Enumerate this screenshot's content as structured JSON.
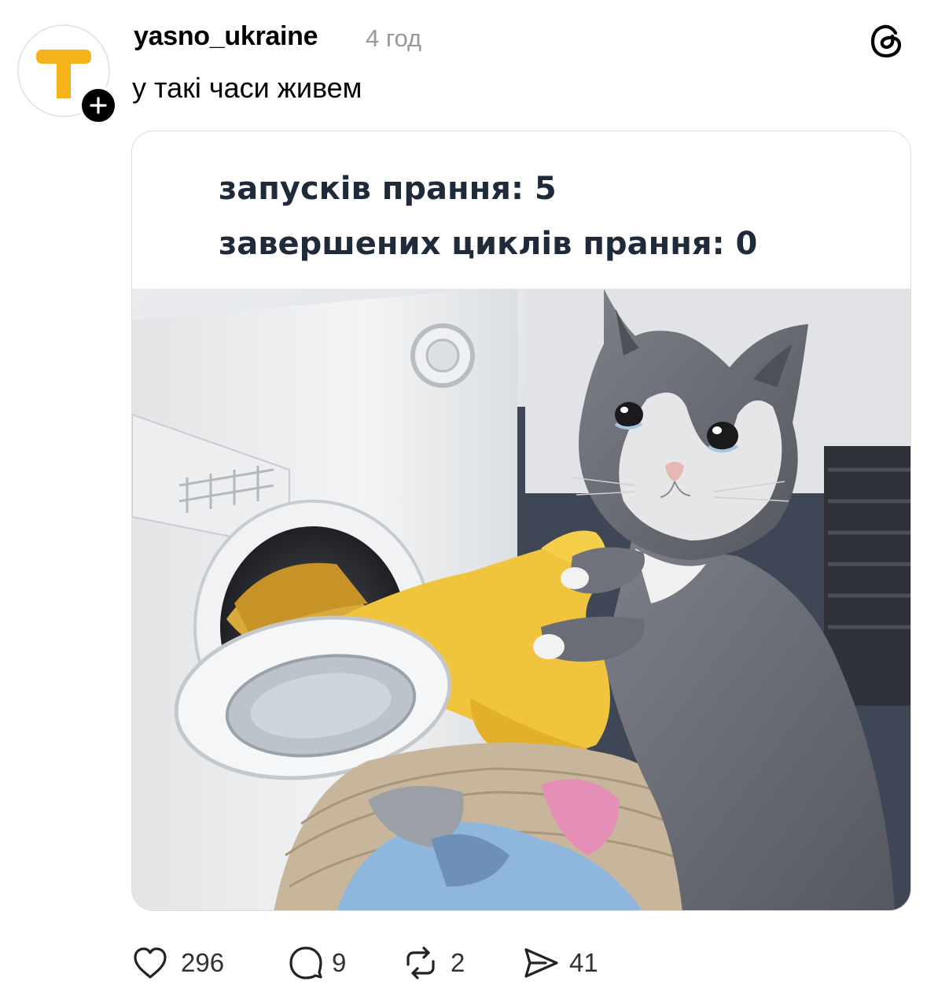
{
  "post": {
    "username": "yasno_ukraine",
    "timestamp": "4 год",
    "caption": "у такі часи живем"
  },
  "meme": {
    "line1": "запусків прання: 5",
    "line2": "завершених циклів прання: 0"
  },
  "actions": {
    "likes": "296",
    "replies": "9",
    "reposts": "2",
    "shares": "41"
  },
  "colors": {
    "brand_yellow": "#f5b21a",
    "meme_text": "#1f2a3a",
    "muted": "#999999"
  },
  "icons": {
    "avatar": "yasno-logo-icon",
    "follow": "plus-icon",
    "app": "threads-logo-icon",
    "like": "heart-icon",
    "reply": "comment-icon",
    "repost": "repost-icon",
    "share": "send-icon"
  }
}
